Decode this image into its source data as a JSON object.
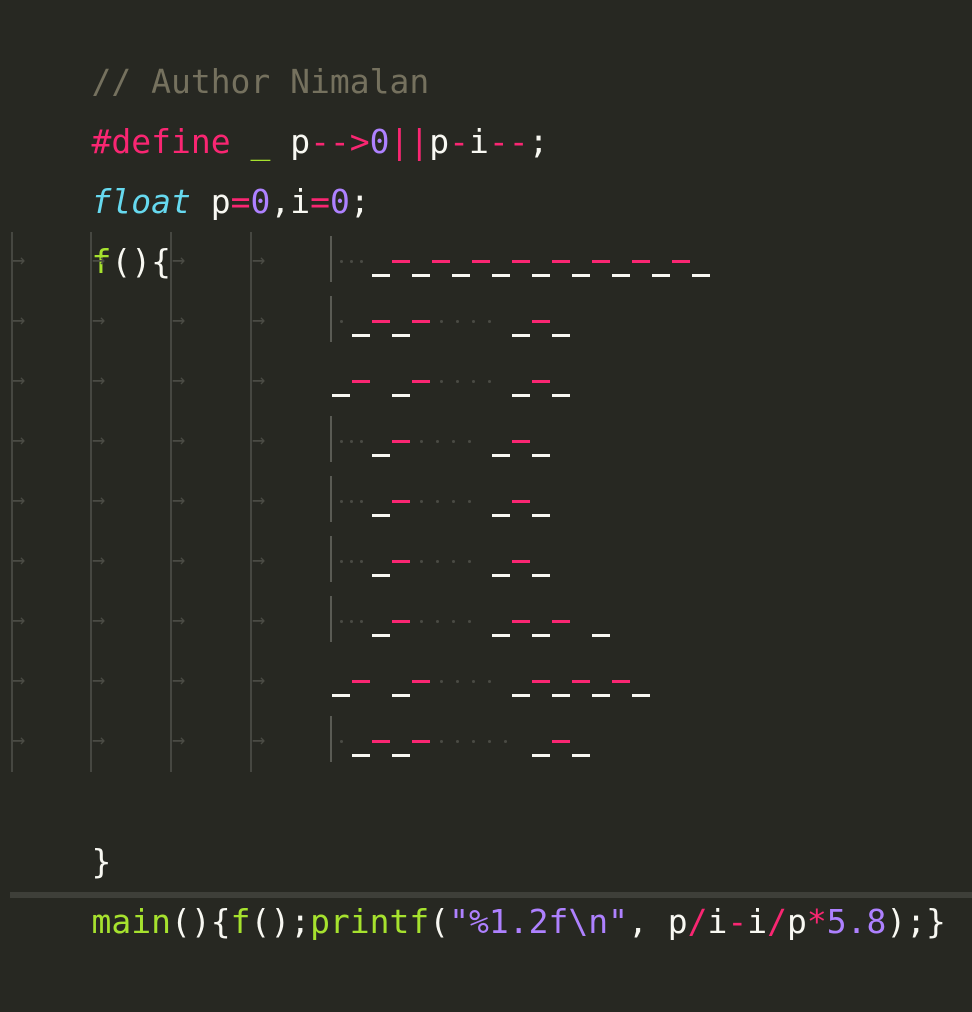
{
  "code": {
    "line1": "// Author Nimalan",
    "line2": {
      "directive": "#define",
      "macro": "_",
      "p1": "p",
      "op1": "-->",
      "n1": "0",
      "op2": "||",
      "p2": "p",
      "op3": "-",
      "i1": "i",
      "op4": "--",
      "semi": ";"
    },
    "line3": {
      "type": "float",
      "a": " p",
      "eq1": "=",
      "z1": "0",
      "comma": ",i",
      "eq2": "=",
      "z2": "0",
      "semi": ";"
    },
    "line4": {
      "fn": "f",
      "rest": "(){"
    },
    "close": "}",
    "main": {
      "fn": "main",
      "p1": "(){",
      "call": "f",
      "p2": "();",
      "printf": "printf",
      "open": "(",
      "str": "\"%1.2f\\n\"",
      "comma": ", p",
      "div1": "/",
      "i1": "i",
      "minus": "-",
      "i2": "i",
      "div2": "/",
      "p": "p",
      "mul": "*",
      "num": "5.8",
      "end": ");}"
    }
  },
  "colors": {
    "background": "#272822",
    "comment": "#75715e",
    "keyword": "#f92672",
    "number": "#ae81ff",
    "type": "#66d9ef",
    "function": "#a6e22e",
    "string": "#e6db74",
    "foreground": "#f8f8f2"
  },
  "icons": {
    "tab_marker": "tab-arrow-icon",
    "tab_glyph": "→"
  }
}
